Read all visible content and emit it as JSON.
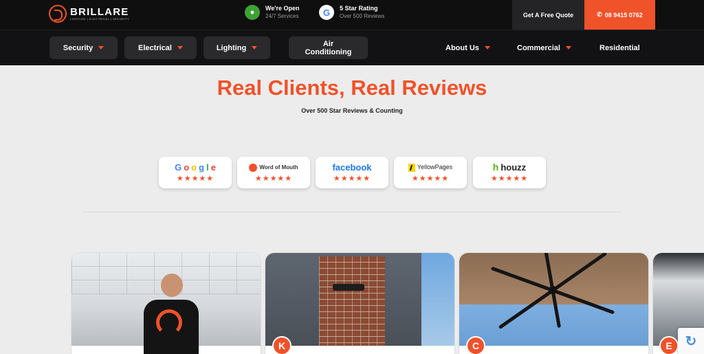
{
  "header": {
    "logo_text": "BRILLARE",
    "logo_tagline": "LIGHTING | ELECTRICAL | SECURITY",
    "badges": [
      {
        "title": "We're Open",
        "sub": "24/7 Services",
        "icon": "lightbulb-icon"
      },
      {
        "title": "5 Star Rating",
        "sub": "Over 500 Reviews",
        "icon": "google-icon"
      }
    ],
    "quote_label": "Get A Free Quote",
    "phone_label": "08 9415 0762"
  },
  "nav": {
    "security": "Security",
    "electrical": "Electrical",
    "lighting": "Lighting",
    "aircon_1": "Air",
    "aircon_2": "Conditioning",
    "about": "About Us",
    "commercial": "Commercial",
    "residential": "Residential"
  },
  "hero": {
    "title": "Real Clients, Real Reviews",
    "subtitle": "Over 500 Star Reviews & Counting"
  },
  "review_platforms": [
    {
      "name": "Google",
      "stars": "★★★★★"
    },
    {
      "name": "Word of Mouth",
      "stars": "★★★★★"
    },
    {
      "name": "facebook",
      "stars": "★★★★★"
    },
    {
      "name": "YellowPages",
      "stars": "★★★★★"
    },
    {
      "name": "houzz",
      "stars": "★★★★★"
    }
  ],
  "reviews": [
    {
      "initial": ""
    },
    {
      "initial": "K"
    },
    {
      "initial": "C"
    },
    {
      "initial": "E"
    }
  ],
  "colors": {
    "accent": "#f0522a",
    "dark": "#0f0f10",
    "nav_pill": "#2a2a2d",
    "page_bg": "#ececec"
  }
}
